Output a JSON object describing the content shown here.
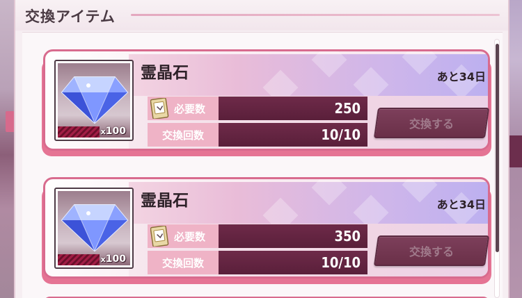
{
  "header": {
    "title": "交換アイテム"
  },
  "items": [
    {
      "name": "霊晶石",
      "quantity": "100",
      "quantity_prefix": "x",
      "remaining": "あと34日",
      "required_label": "必要数",
      "required_value": "250",
      "count_label": "交換回数",
      "count_value": "10/10",
      "button_label": "交換する"
    },
    {
      "name": "霊晶石",
      "quantity": "100",
      "quantity_prefix": "x",
      "remaining": "あと34日",
      "required_label": "必要数",
      "required_value": "350",
      "count_label": "交換回数",
      "count_value": "10/10",
      "button_label": "交換する"
    }
  ],
  "colors": {
    "card_border": "#d86b8e",
    "value_bg": "#6e2a49",
    "label_bg": "#efb3c6"
  },
  "icons": {
    "item_icon": "blue-crystal-gem-icon",
    "cost_icon": "ticket-icon"
  }
}
